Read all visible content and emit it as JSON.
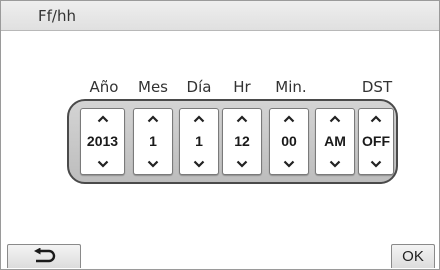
{
  "header": {
    "title": "Ff/hh"
  },
  "columns": [
    {
      "label": "Año",
      "value": "2013"
    },
    {
      "label": "Mes",
      "value": "1"
    },
    {
      "label": "Día",
      "value": "1"
    },
    {
      "label": "Hr",
      "value": "12"
    },
    {
      "label": "Min.",
      "value": "00"
    },
    {
      "label": "",
      "value": "AM"
    },
    {
      "label": "DST",
      "value": "OFF"
    }
  ],
  "icons": {
    "up": "chevron-up-icon",
    "down": "chevron-down-icon",
    "back": "back-arrow-icon"
  },
  "footer": {
    "ok_label": "OK"
  },
  "colors": {
    "title_bar": "#e6e6e6",
    "spinner_frame": "#4a4a4a",
    "spinner_face": "#ffffff"
  }
}
